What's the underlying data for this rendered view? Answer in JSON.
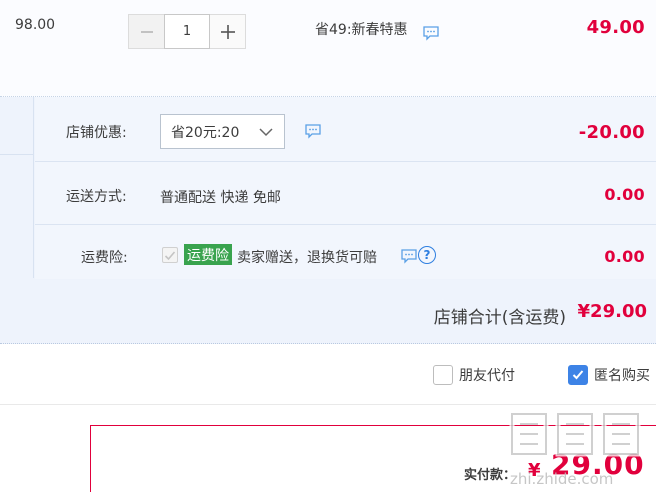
{
  "item": {
    "unit_price": "98.00",
    "quantity": "1",
    "promo_text": "省49:新春特惠",
    "subtotal": "49.00"
  },
  "shop": {
    "discount_label": "店铺优惠:",
    "discount_selected": "省20元:20",
    "discount_amount": "-20.00",
    "shipping_label": "运送方式:",
    "shipping_text": "普通配送 快递 免邮",
    "shipping_amount": "0.00",
    "insurance_label": "运费险:",
    "insurance_badge": "运费险",
    "insurance_text": "卖家赠送，退换货可赔",
    "insurance_amount": "0.00",
    "total_label": "店铺合计(含运费)",
    "total_value": "¥29.00"
  },
  "options": {
    "friend_pay": "朋友代付",
    "anonymous": "匿名购买"
  },
  "payment": {
    "label": "实付款：",
    "currency": "¥",
    "value": "29.00"
  },
  "watermark": {
    "text": "值 什么值得买",
    "site": "zhi.zhide.com"
  },
  "colors": {
    "price_red": "#e1003c",
    "accent_blue": "#3d83e6",
    "insurance_green": "#39a34e",
    "row_bg": "#eef3fc"
  },
  "icons": [
    "minus-icon",
    "plus-icon",
    "chat-icon",
    "chevron-down-icon",
    "checkmark-icon",
    "question-icon"
  ]
}
